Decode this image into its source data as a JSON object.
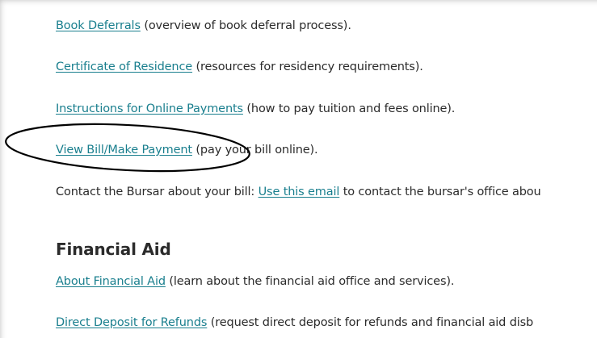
{
  "links": [
    {
      "label": "Book Deferrals",
      "desc": " (overview of book deferral process)."
    },
    {
      "label": "Certificate of Residence",
      "desc": " (resources for residency requirements)."
    },
    {
      "label": "Instructions for Online Payments",
      "desc": " (how to pay tuition and fees online)."
    },
    {
      "label": "View Bill/Make Payment",
      "desc": " (pay your bill online)."
    }
  ],
  "contact": {
    "prefix": "Contact the Bursar about your bill: ",
    "link": "Use this email",
    "suffix": " to contact the bursar's office abou"
  },
  "financial_aid": {
    "heading": "Financial Aid",
    "links": [
      {
        "label": "About Financial Aid",
        "desc": " (learn about the financial aid office and services)."
      },
      {
        "label": "Direct Deposit for Refunds",
        "desc": " (request direct deposit for refunds and financial aid disb"
      }
    ]
  },
  "colors": {
    "link": "#1a7f8e",
    "text": "#2b2b2b",
    "annotation": "#000000"
  }
}
